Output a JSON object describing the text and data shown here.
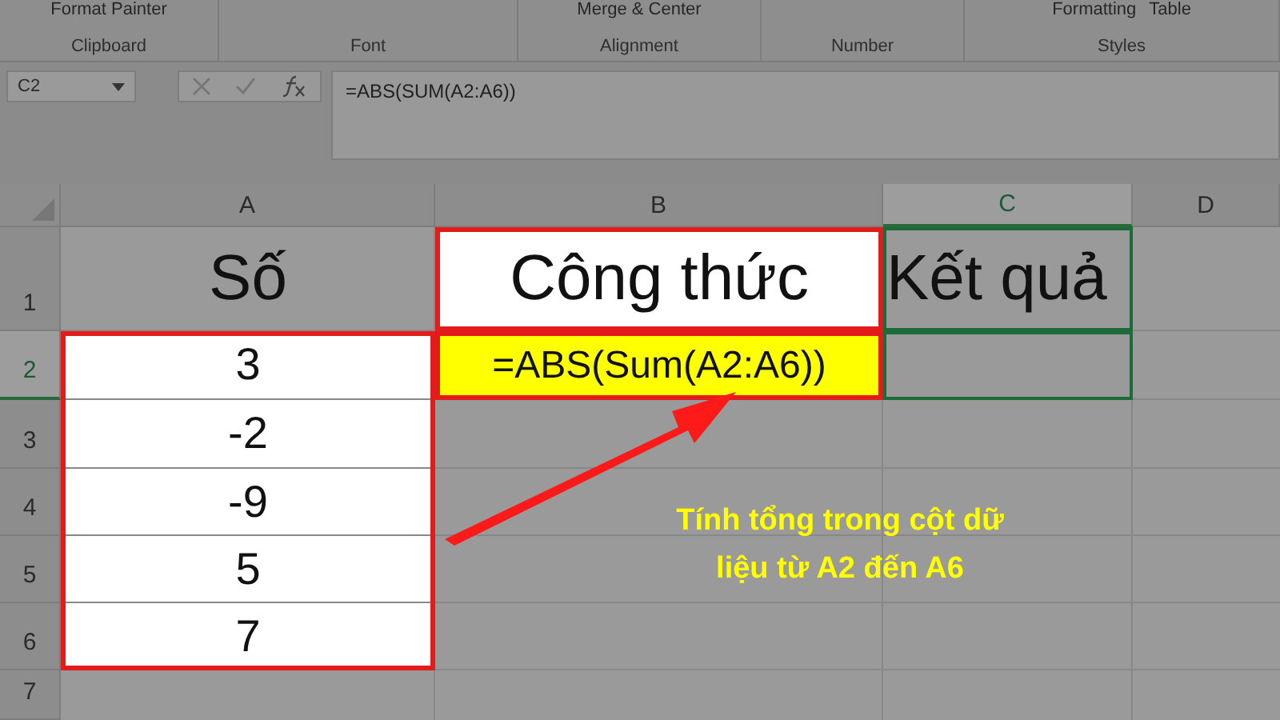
{
  "ribbon": {
    "groups": [
      {
        "label": "Clipboard",
        "items": [
          "Format Painter"
        ]
      },
      {
        "label": "Font"
      },
      {
        "label": "Alignment",
        "items": [
          "Merge & Center"
        ]
      },
      {
        "label": "Number"
      },
      {
        "label": "Styles",
        "items": [
          "Formatting",
          "Table"
        ]
      }
    ]
  },
  "formula_bar": {
    "name_box": "C2",
    "formula": "=ABS(SUM(A2:A6))"
  },
  "sheet": {
    "columns": [
      {
        "label": "A",
        "selected": false
      },
      {
        "label": "B",
        "selected": false
      },
      {
        "label": "C",
        "selected": true
      },
      {
        "label": "D",
        "selected": false
      }
    ],
    "rows": [
      {
        "number": "1",
        "selected": false,
        "cells": [
          {
            "text": "Số",
            "kind": "plain",
            "selected": false
          },
          {
            "text": "Công thức",
            "kind": "framed",
            "selected": false
          },
          {
            "text": "Kết quả",
            "kind": "plain",
            "selected": true
          }
        ]
      },
      {
        "number": "2",
        "selected": true,
        "cells": [
          {
            "text": "3",
            "kind": "listed",
            "selected": false
          },
          {
            "text": "=ABS(Sum(A2:A6))",
            "kind": "formula",
            "selected": false
          },
          {
            "kind": "plain",
            "selected": true
          }
        ]
      },
      {
        "number": "3",
        "selected": false,
        "cells": [
          {
            "text": "-2",
            "kind": "listed",
            "selected": false
          }
        ]
      },
      {
        "number": "4",
        "selected": false,
        "cells": [
          {
            "text": "-9",
            "kind": "listed",
            "selected": false
          }
        ]
      },
      {
        "number": "5",
        "selected": false,
        "cells": [
          {
            "text": "5",
            "kind": "listed",
            "selected": false
          }
        ]
      },
      {
        "number": "6",
        "selected": false,
        "cells": [
          {
            "text": "7",
            "kind": "listed",
            "selected": false
          }
        ]
      },
      {
        "number": "7",
        "selected": false
      }
    ]
  },
  "annotation": {
    "text": "Tính tổng trong cột dữ liệu từ A2 đến A6"
  }
}
